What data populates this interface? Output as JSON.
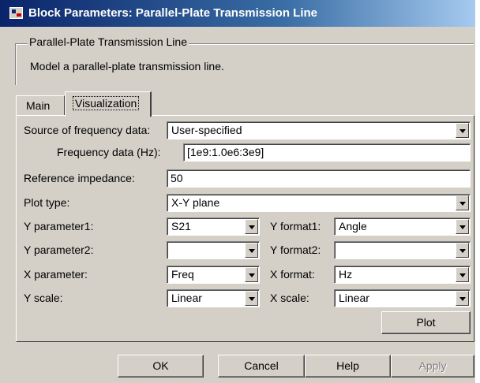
{
  "window": {
    "title": "Block Parameters: Parallel-Plate Transmission Line"
  },
  "group": {
    "legend": "Parallel-Plate Transmission Line",
    "description": "Model a parallel-plate transmission line."
  },
  "tabs": [
    {
      "label": "Main",
      "selected": false
    },
    {
      "label": "Visualization",
      "selected": true
    }
  ],
  "form": {
    "source": {
      "label": "Source of frequency data:",
      "value": "User-specified"
    },
    "frequency": {
      "label": "Frequency data (Hz):",
      "value": "[1e9:1.0e6:3e9]"
    },
    "impedance": {
      "label": "Reference impedance:",
      "value": "50"
    },
    "plot_type": {
      "label": "Plot type:",
      "value": "X-Y plane"
    },
    "y_param1": {
      "label": "Y parameter1:",
      "value": "S21"
    },
    "y_format1": {
      "label": "Y format1:",
      "value": "Angle"
    },
    "y_param2": {
      "label": "Y parameter2:",
      "value": ""
    },
    "y_format2": {
      "label": "Y format2:",
      "value": ""
    },
    "x_param": {
      "label": "X parameter:",
      "value": "Freq"
    },
    "x_format": {
      "label": "X format:",
      "value": "Hz"
    },
    "y_scale": {
      "label": "Y scale:",
      "value": "Linear"
    },
    "x_scale": {
      "label": "X scale:",
      "value": "Linear"
    },
    "plot_button": "Plot"
  },
  "buttons": {
    "ok": "OK",
    "cancel": "Cancel",
    "help": "Help",
    "apply": "Apply"
  }
}
